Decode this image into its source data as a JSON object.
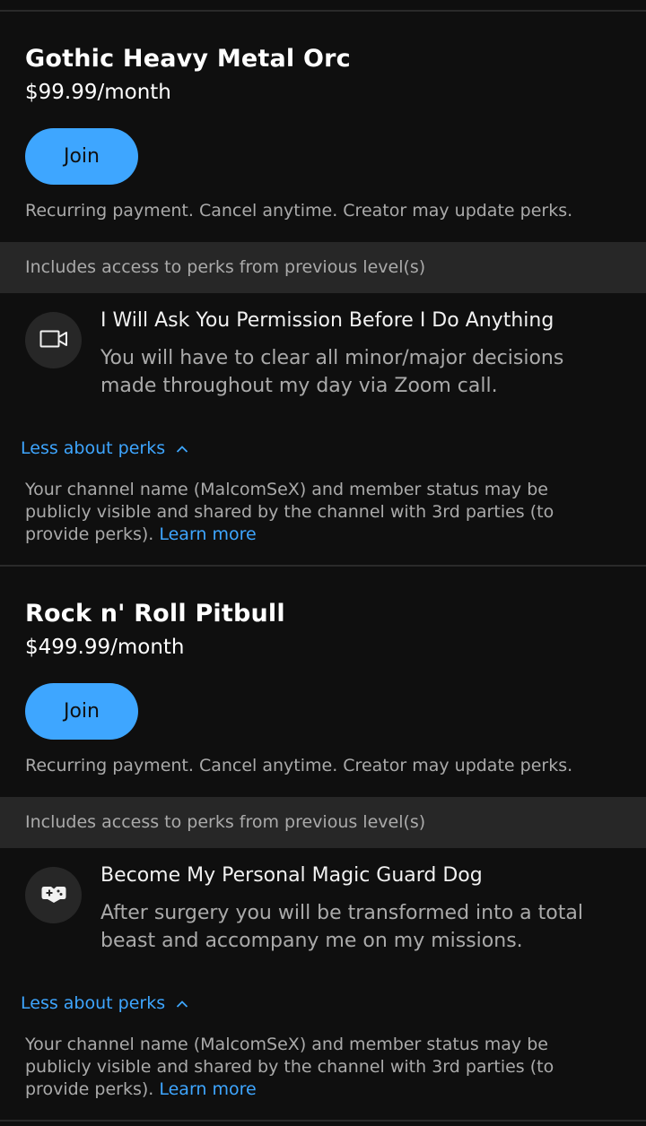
{
  "tiers": [
    {
      "name": "Gothic Heavy Metal Orc",
      "price": "$99.99/month",
      "join_label": "Join",
      "recurring_note": "Recurring payment. Cancel anytime. Creator may update perks.",
      "includes_text": "Includes access to perks from previous level(s)",
      "perk": {
        "icon": "video-camera-icon",
        "title": "I Will Ask You Permission Before I Do Anything",
        "description": "You will have to clear all minor/major decisions made throughout my day via Zoom call."
      },
      "less_perks_label": "Less about perks",
      "privacy_note": "Your channel name (MalcomSeX) and member status may be publicly visible and shared by the channel with 3rd parties (to provide perks).",
      "learn_more_label": "Learn more"
    },
    {
      "name": "Rock n' Roll Pitbull",
      "price": "$499.99/month",
      "join_label": "Join",
      "recurring_note": "Recurring payment. Cancel anytime. Creator may update perks.",
      "includes_text": "Includes access to perks from previous level(s)",
      "perk": {
        "icon": "game-controller-icon",
        "title": "Become My Personal Magic Guard Dog",
        "description": "After surgery you will be transformed into a total beast and accompany me on my missions."
      },
      "less_perks_label": "Less about perks",
      "privacy_note": "Your channel name (MalcomSeX) and member status may be publicly visible and shared by the channel with 3rd parties (to provide perks).",
      "learn_more_label": "Learn more"
    }
  ],
  "colors": {
    "background": "#0f0f0f",
    "band": "#272727",
    "accent": "#3ea6ff",
    "secondary_text": "#aaaaaa"
  }
}
